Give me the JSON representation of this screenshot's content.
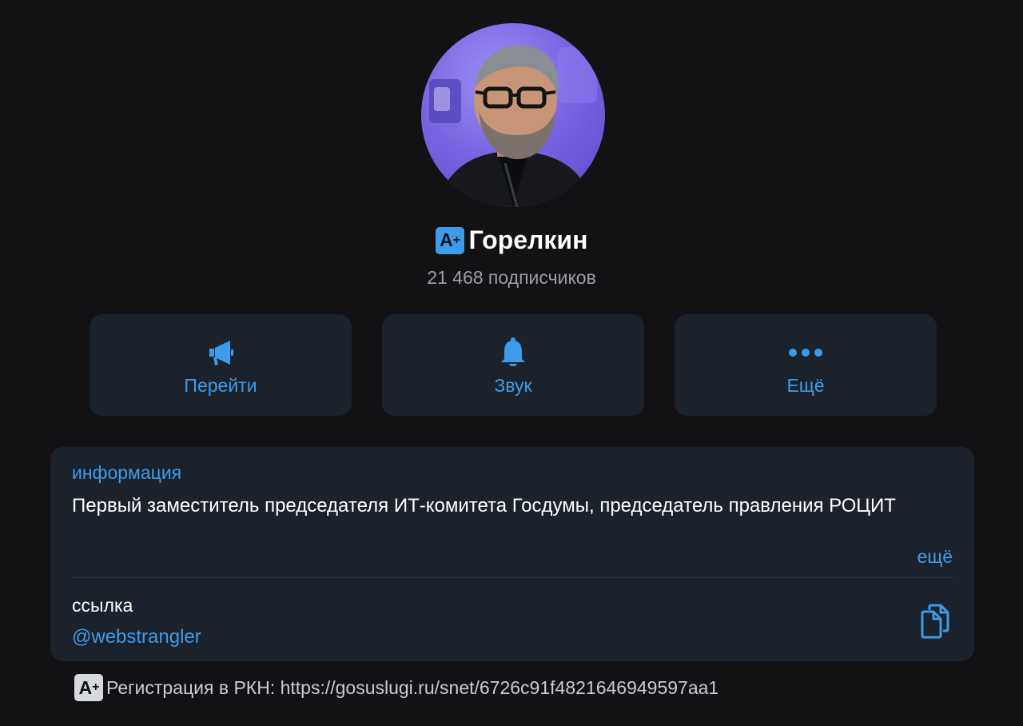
{
  "profile": {
    "badge_text": "A",
    "badge_plus": "+",
    "name": "Горелкин",
    "subscribers": "21 468 подписчиков"
  },
  "actions": [
    {
      "label": "Перейти",
      "icon": "megaphone-icon"
    },
    {
      "label": "Звук",
      "icon": "bell-icon"
    },
    {
      "label": "Ещё",
      "icon": "more-dots-icon"
    }
  ],
  "info": {
    "title": "информация",
    "description": "Первый заместитель председателя ИТ-комитета Госдумы, председатель правления РОЦИТ",
    "more_label": "ещё",
    "link_title": "ссылка",
    "link_value": "@webstrangler",
    "copy_icon": "copy-icon"
  },
  "footer": {
    "badge_text": "A",
    "badge_plus": "+",
    "text": "Регистрация в РКН: https://gosuslugi.ru/snet/6726c91f4821646949597aa1"
  },
  "colors": {
    "background": "#121214",
    "card": "#1b222c",
    "accent": "#3d9be9",
    "muted_text": "#9aa0a6"
  }
}
